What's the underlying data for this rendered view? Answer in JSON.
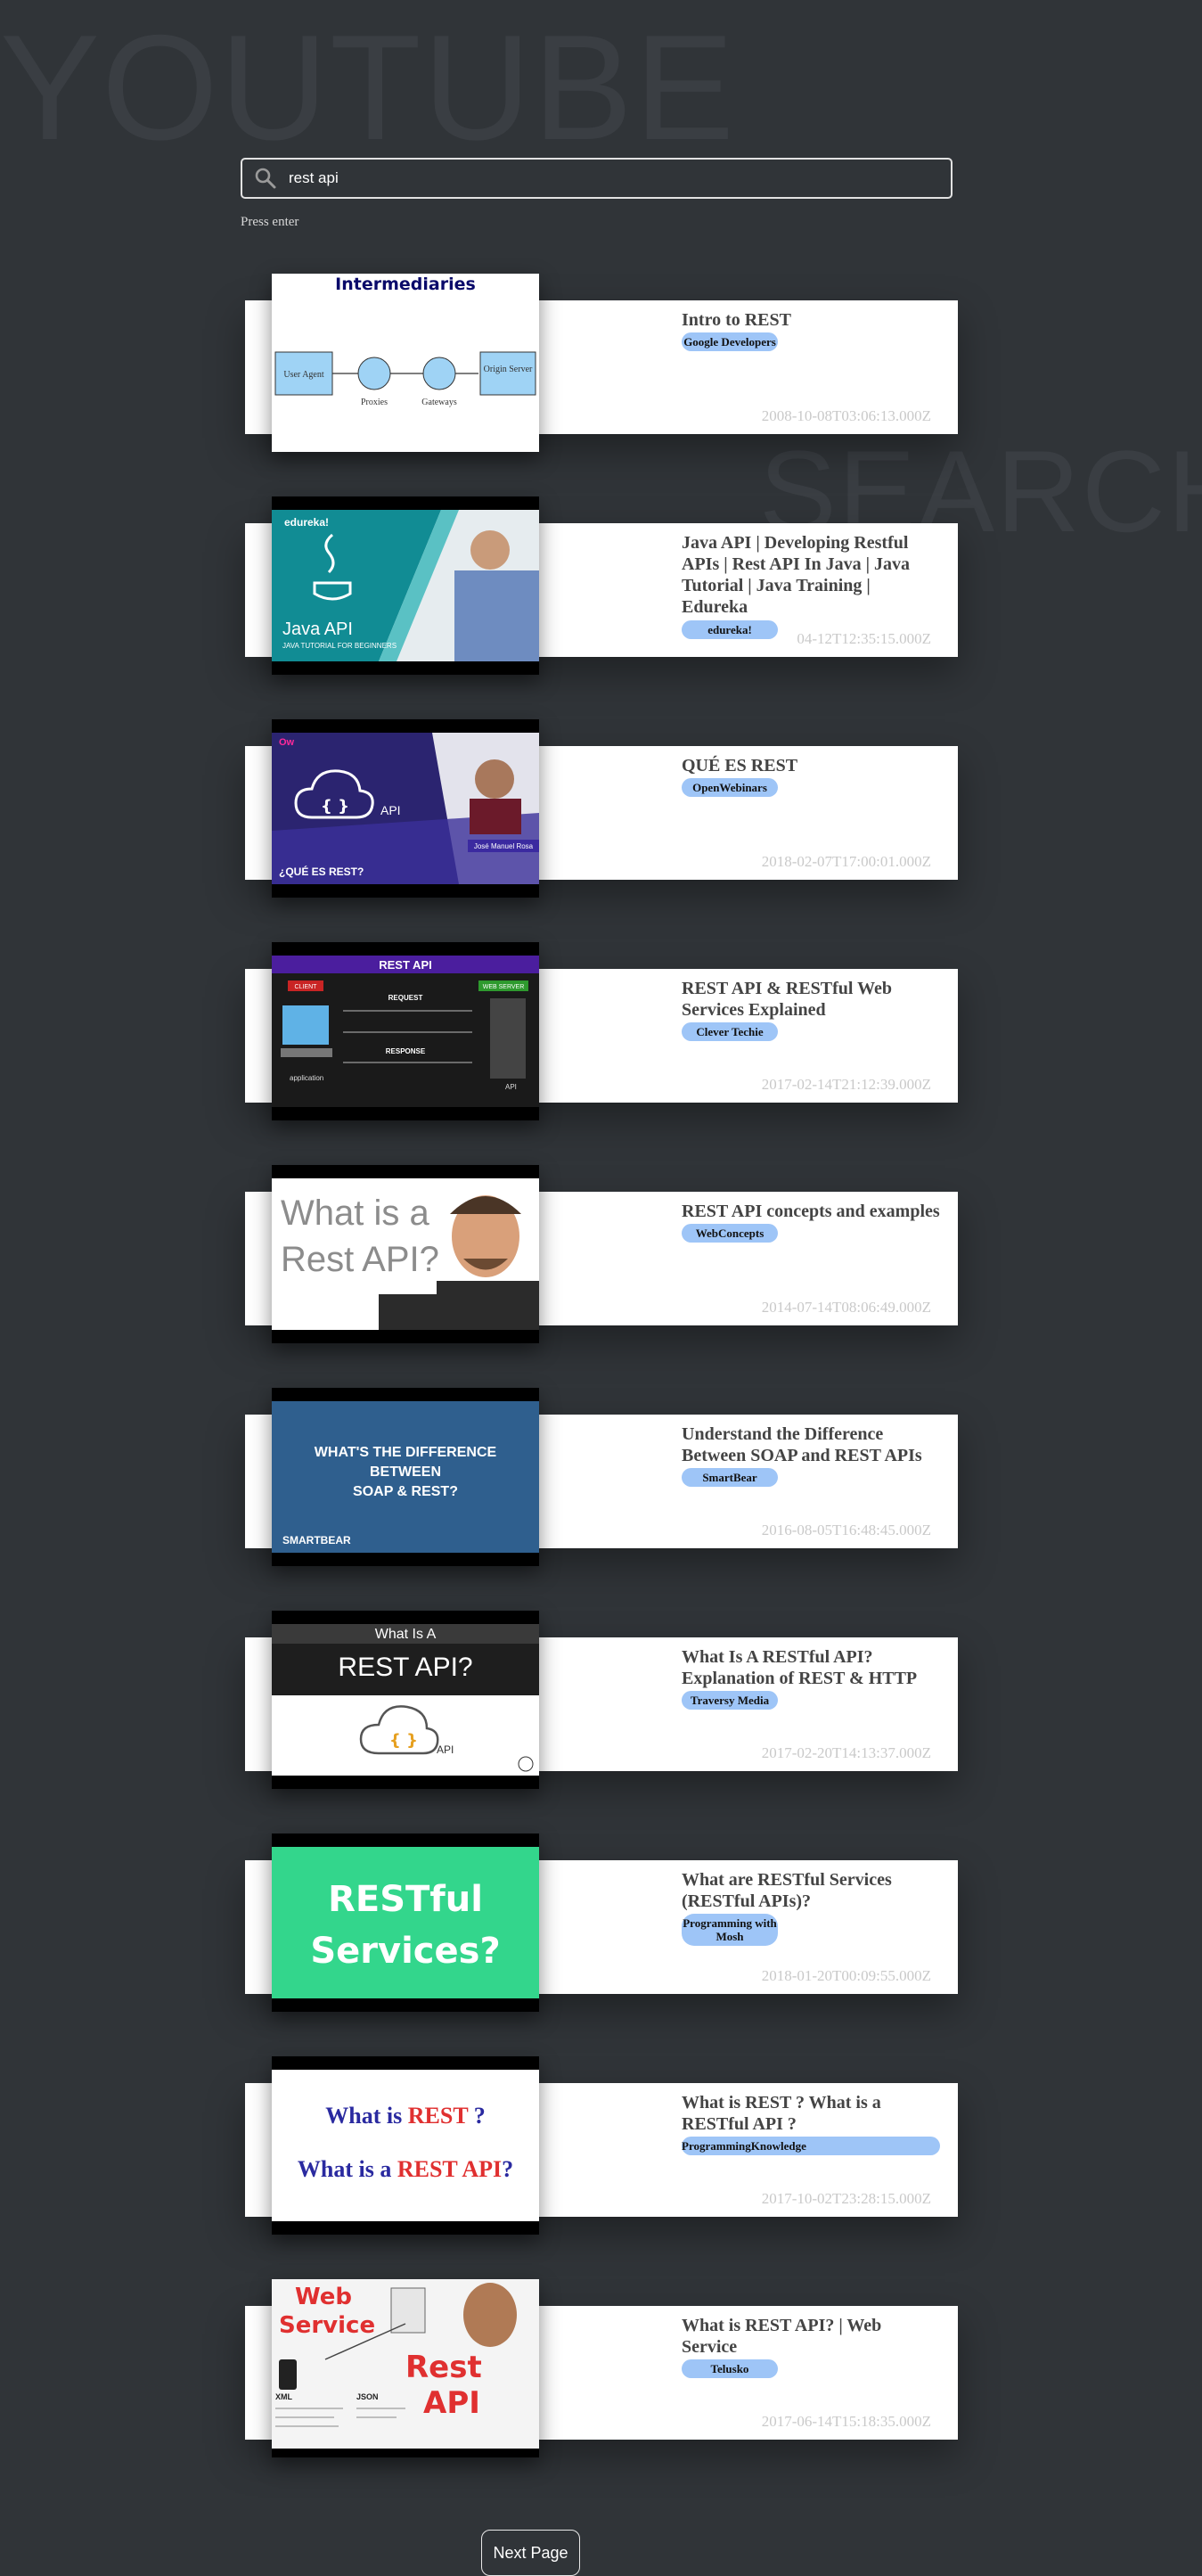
{
  "background": {
    "word1": "YOUTUBE",
    "word2": "SEARCH"
  },
  "search": {
    "value": "rest api",
    "hint": "Press enter"
  },
  "results": [
    {
      "title": "Intro to REST",
      "channel": "Google Developers",
      "date": "2008-10-08T03:06:13.000Z",
      "thumb": {
        "heading": "Intermediaries",
        "labels": [
          "User Agent",
          "Proxies",
          "Gateways",
          "Origin Server"
        ]
      }
    },
    {
      "title": "Java API | Developing Restful APIs | Rest API In Java | Java Tutorial | Java Training | Edureka",
      "channel": "edureka!",
      "date": "04-12T12:35:15.000Z",
      "thumb": {
        "brand": "edureka!",
        "heading": "Java API",
        "sub": "JAVA TUTORIAL FOR BEGINNERS"
      }
    },
    {
      "title": "QUÉ ES REST",
      "channel": "OpenWebinars",
      "date": "2018-02-07T17:00:01.000Z",
      "thumb": {
        "logo": "Ow",
        "cloud": "API",
        "name": "José Manuel Rosa",
        "question": "¿QUÉ ES REST?"
      }
    },
    {
      "title": "REST API & RESTful Web Services Explained",
      "channel": "Clever Techie",
      "date": "2017-02-14T21:12:39.000Z",
      "thumb": {
        "heading": "REST API",
        "client": "CLIENT",
        "server": "WEB SERVER",
        "request": "REQUEST",
        "response": "RESPONSE",
        "app": "application",
        "api": "API"
      }
    },
    {
      "title": "REST API concepts and examples",
      "channel": "WebConcepts",
      "date": "2014-07-14T08:06:49.000Z",
      "thumb": {
        "line1": "What is a",
        "line2": "Rest API?"
      }
    },
    {
      "title": "Understand the Difference Between SOAP and REST APIs",
      "channel": "SmartBear",
      "date": "2016-08-05T16:48:45.000Z",
      "thumb": {
        "line1": "WHAT'S THE DIFFERENCE",
        "line2": "BETWEEN",
        "line3": "SOAP & REST?",
        "brand": "SMARTBEAR"
      }
    },
    {
      "title": "What Is A RESTful API? Explanation of REST & HTTP",
      "channel": "Traversy Media",
      "date": "2017-02-20T14:13:37.000Z",
      "thumb": {
        "line1": "What Is A",
        "line2": "REST API?",
        "cloud": "API"
      }
    },
    {
      "title": "What are RESTful Services (RESTful APIs)?",
      "channel": "Programming with Mosh",
      "date": "2018-01-20T00:09:55.000Z",
      "thumb": {
        "line1": "RESTful",
        "line2": "Services?"
      }
    },
    {
      "title": "What is REST ? What is a RESTful API ?",
      "channel": "ProgrammingKnowledge",
      "date": "2017-10-02T23:28:15.000Z",
      "thumb": {
        "q1a": "What is ",
        "q1b": "REST",
        "q1c": " ?",
        "q2a": "What is a ",
        "q2b": "REST API",
        "q2c": "?"
      }
    },
    {
      "title": "What is REST API? | Web Service",
      "channel": "Telusko",
      "date": "2017-06-14T15:18:35.000Z",
      "thumb": {
        "line1": "Web",
        "line2": "Service",
        "line3": "Rest",
        "line4": "API",
        "xml": "XML",
        "json": "JSON"
      }
    }
  ],
  "pagination": {
    "next_label": "Next Page"
  },
  "colors": {
    "background": "#303438",
    "card": "#ffffff",
    "badge": "#9ec5f7",
    "date": "#c9c9c9"
  }
}
